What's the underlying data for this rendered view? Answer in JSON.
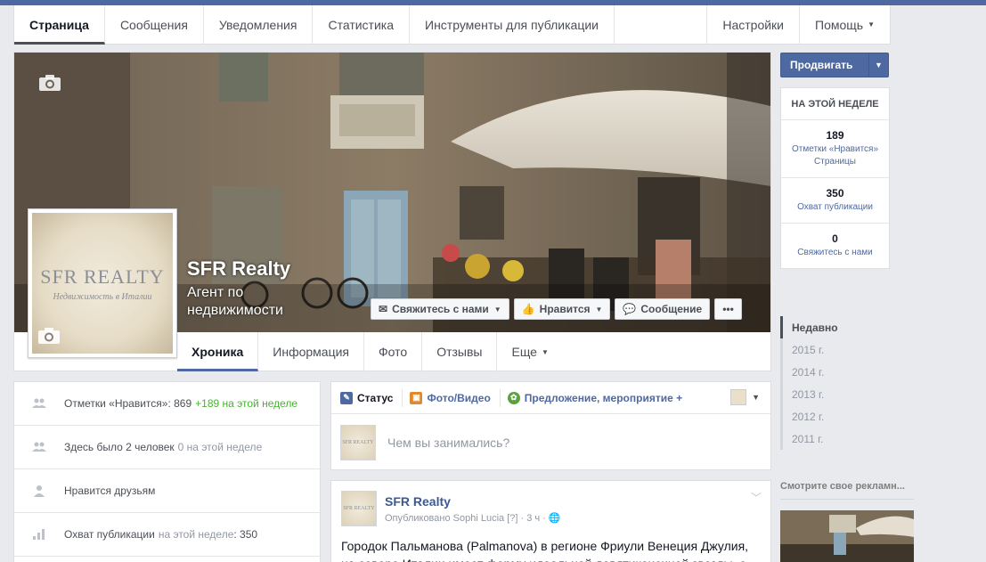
{
  "admin_nav": {
    "tabs": [
      "Страница",
      "Сообщения",
      "Уведомления",
      "Статистика",
      "Инструменты для публикации"
    ],
    "settings": "Настройки",
    "help": "Помощь"
  },
  "page": {
    "name": "SFR Realty",
    "category": "Агент по недвижимости",
    "logo_line1": "SFR REALTY",
    "logo_line2": "Недвижимость в Италии"
  },
  "cover_buttons": {
    "contact": "Свяжитесь с нами",
    "like": "Нравится",
    "message": "Сообщение",
    "more": "•••"
  },
  "timeline_tabs": [
    "Хроника",
    "Информация",
    "Фото",
    "Отзывы",
    "Еще"
  ],
  "promote": {
    "label": "Продвигать"
  },
  "this_week": {
    "title": "НА ЭТОЙ НЕДЕЛЕ",
    "stats": [
      {
        "num": "189",
        "label": "Отметки «Нравится» Страницы"
      },
      {
        "num": "350",
        "label": "Охват публикации"
      },
      {
        "num": "0",
        "label": "Свяжитесь с нами"
      }
    ]
  },
  "years": [
    "Недавно",
    "2015 г.",
    "2014 г.",
    "2013 г.",
    "2012 г.",
    "2011 г."
  ],
  "ads": {
    "title": "Смотрите свое рекламн..."
  },
  "left_stats": [
    {
      "icon": "people-icon",
      "text": "Отметки «Нравится»: 869",
      "extra": "+189 на этой неделе",
      "extra_color": "green"
    },
    {
      "icon": "people-icon",
      "text": "Здесь было 2 человек",
      "extra": "0 на этой неделе",
      "extra_color": "grey"
    },
    {
      "icon": "person-like-icon",
      "text": "Нравится друзьям",
      "extra": "",
      "extra_color": "grey"
    },
    {
      "icon": "bar-chart-icon",
      "text": "Охват публикации",
      "extra": "на этой неделе",
      "extra_color": "grey",
      "suffix": ": 350"
    }
  ],
  "composer": {
    "tabs": [
      "Статус",
      "Фото/Видео",
      "Предложение, мероприятие +"
    ],
    "placeholder": "Чем вы занимались?"
  },
  "post": {
    "author": "SFR Realty",
    "meta": "Опубликовано Sophi Lucia [?] · 3 ч ·",
    "text": "Городок Пальманова (Palmanova) в регионе Фриули Венеция Джулия, на севере Италии имеет форму идеальной девятиконечной звезды, с"
  },
  "colors": {
    "accent": "#4e69a2",
    "link": "#3b5998",
    "green": "#42b72a"
  }
}
